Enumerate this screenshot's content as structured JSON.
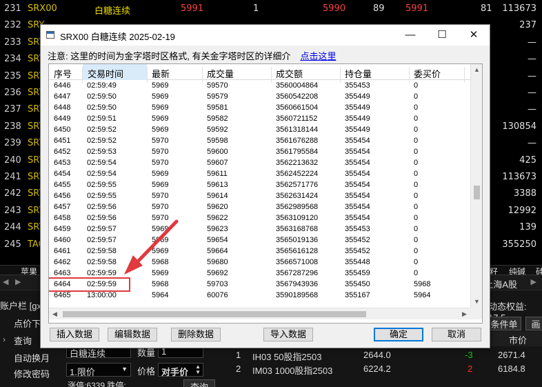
{
  "background": {
    "rows": [
      {
        "num": "231",
        "code": "SRX00",
        "name": "白糖连续",
        "px": "5991",
        "vol": "1",
        "bid": "5990",
        "bv": "89",
        "ask": "5991",
        "av": "81",
        "last": "113673"
      },
      {
        "num": "232",
        "code": "SRY",
        "name": "",
        "px": "",
        "vol": "",
        "bid": "",
        "bv": "",
        "ask": "",
        "av": "",
        "last": "237"
      },
      {
        "num": "233",
        "code": "SRY",
        "name": "",
        "px": "",
        "vol": "",
        "bid": "",
        "bv": "",
        "ask": "",
        "av": "",
        "last": "—"
      },
      {
        "num": "234",
        "code": "SRY",
        "name": "",
        "px": "",
        "vol": "",
        "bid": "",
        "bv": "",
        "ask": "",
        "av": "",
        "last": "—"
      },
      {
        "num": "235",
        "code": "SRY",
        "name": "",
        "px": "",
        "vol": "",
        "bid": "",
        "bv": "",
        "ask": "",
        "av": "",
        "last": "—"
      },
      {
        "num": "236",
        "code": "SRY",
        "name": "",
        "px": "",
        "vol": "",
        "bid": "",
        "bv": "",
        "ask": "",
        "av": "",
        "last": "—"
      },
      {
        "num": "237",
        "code": "SRY",
        "name": "",
        "px": "",
        "vol": "",
        "bid": "",
        "bv": "",
        "ask": "",
        "av": "",
        "last": "—"
      },
      {
        "num": "238",
        "code": "SRY",
        "name": "",
        "px": "",
        "vol": "",
        "bid": "",
        "bv": "",
        "ask": "",
        "av": "",
        "last": "130854"
      },
      {
        "num": "239",
        "code": "SRY",
        "name": "",
        "px": "",
        "vol": "",
        "bid": "",
        "bv": "",
        "ask": "",
        "av": "",
        "last": "—"
      },
      {
        "num": "240",
        "code": "SRY",
        "name": "",
        "px": "",
        "vol": "",
        "bid": "",
        "bv": "",
        "ask": "",
        "av": "",
        "last": "425"
      },
      {
        "num": "241",
        "code": "SRY",
        "name": "",
        "px": "",
        "vol": "",
        "bid": "",
        "bv": "",
        "ask": "",
        "av": "",
        "last": "113673"
      },
      {
        "num": "242",
        "code": "SRY",
        "name": "",
        "px": "",
        "vol": "",
        "bid": "",
        "bv": "",
        "ask": "",
        "av": "",
        "last": "3388"
      },
      {
        "num": "243",
        "code": "SRY",
        "name": "",
        "px": "",
        "vol": "",
        "bid": "",
        "bv": "",
        "ask": "",
        "av": "",
        "last": "12992"
      },
      {
        "num": "244",
        "code": "SRY",
        "name": "",
        "px": "",
        "vol": "",
        "bid": "",
        "bv": "",
        "ask": "",
        "av": "",
        "last": "139"
      },
      {
        "num": "245",
        "code": "TAO",
        "name": "",
        "px": "",
        "vol": "",
        "bid": "",
        "bv": "",
        "ask": "",
        "av": "",
        "last": "355250"
      }
    ],
    "bottom_tabs": {
      "left": "苹果",
      "right1": "籽",
      "right2": "纯碱",
      "right3": "硅"
    },
    "market_label": "上海A股"
  },
  "trade": {
    "account": "账户栏 [gx",
    "menu": [
      "点价下",
      "查询",
      "自动换月",
      "修改密码",
      "交易设置"
    ],
    "instrument": "白糖连续",
    "qty_label": "数量",
    "qty": "1",
    "order_type": "1.限价",
    "price_label": "价格",
    "price_mode": "对手价",
    "limits": "涨停:6339 跌停:",
    "query_btn": "查询",
    "dyn_equity": "动态权益: 17,5",
    "cond_order": "条件单",
    "market_price_hdr": "市价",
    "positions": [
      {
        "idx": "1",
        "name": "IH03 50股指2503",
        "price": "2644.0",
        "chg": "-3",
        "mkt": "2671.4"
      },
      {
        "idx": "2",
        "name": "IM03 1000股指2503",
        "price": "6224.2",
        "chg": "2",
        "mkt": "6184.8"
      }
    ]
  },
  "dialog": {
    "title": "SRX00 白糖连续 2025-02-19",
    "minimize": "—",
    "maximize": "☐",
    "close": "✕",
    "notice": "注意: 这里的时间为金字塔时区格式, 有关金字塔时区的详细介",
    "notice_link": "点击这里",
    "columns": [
      "序号",
      "交易时间",
      "最新",
      "成交量",
      "成交额",
      "持仓量",
      "委买价"
    ],
    "rows": [
      [
        "6446",
        "02:59:49",
        "5969",
        "59570",
        "3560004864",
        "355453",
        "0"
      ],
      [
        "6447",
        "02:59:50",
        "5969",
        "59579",
        "3560542208",
        "355449",
        "0"
      ],
      [
        "6448",
        "02:59:50",
        "5969",
        "59581",
        "3560661504",
        "355449",
        "0"
      ],
      [
        "6449",
        "02:59:51",
        "5969",
        "59582",
        "3560721152",
        "355449",
        "0"
      ],
      [
        "6450",
        "02:59:52",
        "5969",
        "59592",
        "3561318144",
        "355449",
        "0"
      ],
      [
        "6451",
        "02:59:52",
        "5970",
        "59598",
        "3561676288",
        "355454",
        "0"
      ],
      [
        "6452",
        "02:59:53",
        "5970",
        "59600",
        "3561795584",
        "355454",
        "0"
      ],
      [
        "6453",
        "02:59:54",
        "5970",
        "59607",
        "3562213632",
        "355454",
        "0"
      ],
      [
        "6454",
        "02:59:54",
        "5969",
        "59611",
        "3562452224",
        "355454",
        "0"
      ],
      [
        "6455",
        "02:59:55",
        "5969",
        "59613",
        "3562571776",
        "355454",
        "0"
      ],
      [
        "6456",
        "02:59:55",
        "5970",
        "59614",
        "3562631424",
        "355454",
        "0"
      ],
      [
        "6457",
        "02:59:56",
        "5970",
        "59620",
        "3562989568",
        "355454",
        "0"
      ],
      [
        "6458",
        "02:59:56",
        "5970",
        "59622",
        "3563109120",
        "355454",
        "0"
      ],
      [
        "6459",
        "02:59:57",
        "5969",
        "59623",
        "3563168768",
        "355453",
        "0"
      ],
      [
        "6460",
        "02:59:57",
        "5969",
        "59654",
        "3565019136",
        "355452",
        "0"
      ],
      [
        "6461",
        "02:59:58",
        "5969",
        "59664",
        "3565616128",
        "355452",
        "0"
      ],
      [
        "6462",
        "02:59:58",
        "5968",
        "59680",
        "3566571008",
        "355448",
        "0"
      ],
      [
        "6463",
        "02:59:59",
        "5969",
        "59692",
        "3567287296",
        "355459",
        "0"
      ],
      [
        "6464",
        "02:59:59",
        "5968",
        "59703",
        "3567943936",
        "355450",
        "5968"
      ],
      [
        "6465",
        "13:00:00",
        "5964",
        "60076",
        "3590189568",
        "355167",
        "5964"
      ]
    ],
    "buttons": {
      "insert": "插入数据",
      "edit": "编辑数据",
      "delete": "删除数据",
      "import": "导入数据",
      "ok": "确定",
      "cancel": "取消"
    }
  },
  "colors": {
    "annotation": "#e0393e",
    "selected_header": "#d9ebf9",
    "link": "#0000ee"
  }
}
